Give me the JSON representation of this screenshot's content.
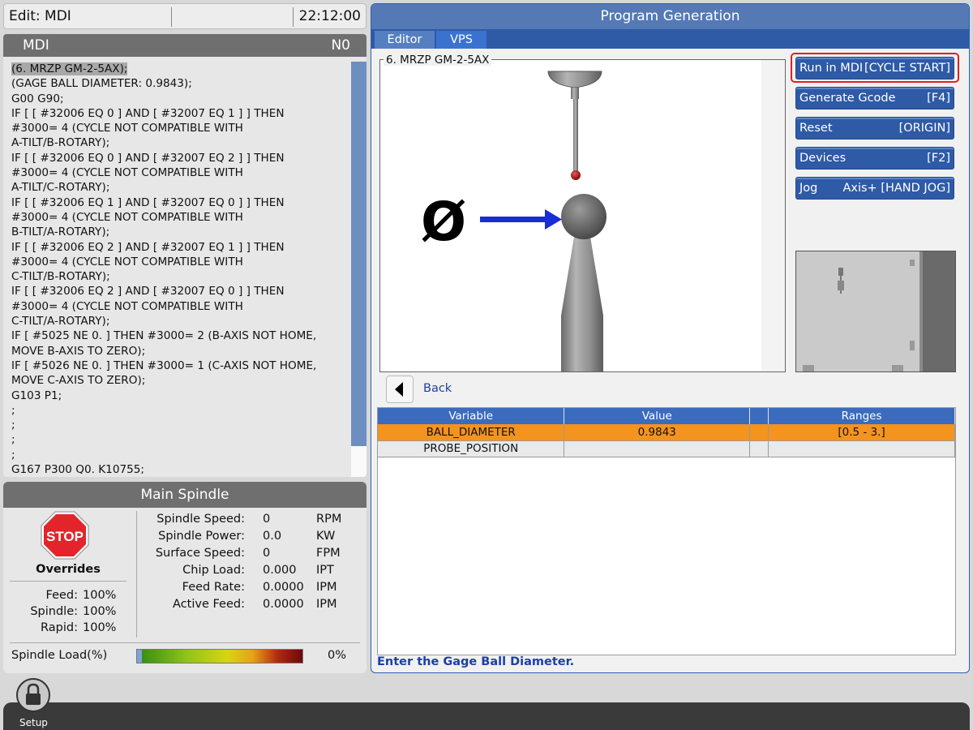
{
  "topbar": {
    "mode": "Edit: MDI",
    "clock": "22:12:00"
  },
  "mdi": {
    "title": "MDI",
    "line_number": "N0",
    "lines": [
      "(6. MRZP GM-2-5AX);",
      "(GAGE BALL DIAMETER: 0.9843);",
      "G00 G90;",
      "IF [ [ #32006 EQ 0 ] AND [ #32007 EQ 1 ] ] THEN",
      "#3000= 4 (CYCLE NOT COMPATIBLE WITH",
      "A-TILT/B-ROTARY);",
      "IF [ [ #32006 EQ 0 ] AND [ #32007 EQ 2 ] ] THEN",
      "#3000= 4 (CYCLE NOT COMPATIBLE WITH",
      "A-TILT/C-ROTARY);",
      "IF [ [ #32006 EQ 1 ] AND [ #32007 EQ 0 ] ] THEN",
      "#3000= 4 (CYCLE NOT COMPATIBLE WITH",
      "B-TILT/A-ROTARY);",
      "IF [ [ #32006 EQ 2 ] AND [ #32007 EQ 1 ] ] THEN",
      "#3000= 4 (CYCLE NOT COMPATIBLE WITH",
      "C-TILT/B-ROTARY);",
      "IF [ [ #32006 EQ 2 ] AND [ #32007 EQ 0 ] ] THEN",
      "#3000= 4 (CYCLE NOT COMPATIBLE WITH",
      "C-TILT/A-ROTARY);",
      "IF [ #5025 NE 0. ] THEN #3000= 2 (B-AXIS NOT HOME,",
      "MOVE B-AXIS TO ZERO);",
      "IF [ #5026 NE 0. ] THEN #3000= 1 (C-AXIS NOT HOME,",
      "MOVE C-AXIS TO ZERO);",
      "G103 P1;",
      ";",
      ";",
      ";",
      ";",
      "G167 P300 Q0. K10755;"
    ]
  },
  "spindle": {
    "title": "Main Spindle",
    "stop_label": "STOP",
    "overrides_title": "Overrides",
    "overrides": [
      {
        "label": "Feed:",
        "value": "100%"
      },
      {
        "label": "Spindle:",
        "value": "100%"
      },
      {
        "label": "Rapid:",
        "value": "100%"
      }
    ],
    "stats": [
      {
        "label": "Spindle Speed:",
        "value": "0",
        "unit": "RPM"
      },
      {
        "label": "Spindle Power:",
        "value": "0.0",
        "unit": "KW"
      },
      {
        "label": "Surface Speed:",
        "value": "0",
        "unit": "FPM"
      },
      {
        "label": "Chip Load:",
        "value": "0.000",
        "unit": "IPT"
      },
      {
        "label": "Feed Rate:",
        "value": "0.0000",
        "unit": "IPM"
      },
      {
        "label": "Active Feed:",
        "value": "0.0000",
        "unit": "IPM"
      }
    ],
    "load_label": "Spindle Load(%)",
    "load_value": "0%",
    "load_fraction": 0
  },
  "program_generation": {
    "title": "Program Generation",
    "tabs": [
      "Editor",
      "VPS"
    ],
    "active_tab": "VPS",
    "figure_title": "6. MRZP GM-2-5AX",
    "diameter_symbol": "Ø",
    "buttons": [
      {
        "label": "Run in MDI",
        "key": "[CYCLE START]"
      },
      {
        "label": "Generate Gcode",
        "key": "[F4]"
      },
      {
        "label": "Reset",
        "key": "[ORIGIN]"
      },
      {
        "label": "Devices",
        "key": "[F2]"
      },
      {
        "label": "Jog",
        "key": "Axis+ [HAND JOG]"
      }
    ],
    "back_label": "Back",
    "table": {
      "headers": [
        "Variable",
        "Value",
        "",
        "Ranges"
      ],
      "rows": [
        {
          "variable": "BALL_DIAMETER",
          "value": "0.9843",
          "extra": "",
          "range": "[0.5 - 3.]"
        },
        {
          "variable": "PROBE_POSITION",
          "value": "",
          "extra": "",
          "range": ""
        }
      ]
    },
    "status": "Enter the Gage Ball Diameter."
  },
  "footer": {
    "setup_label": "Setup"
  },
  "colors": {
    "accent": "#2e5aa6",
    "selected_row": "#f4931e",
    "highlight_border": "#dd2222"
  }
}
